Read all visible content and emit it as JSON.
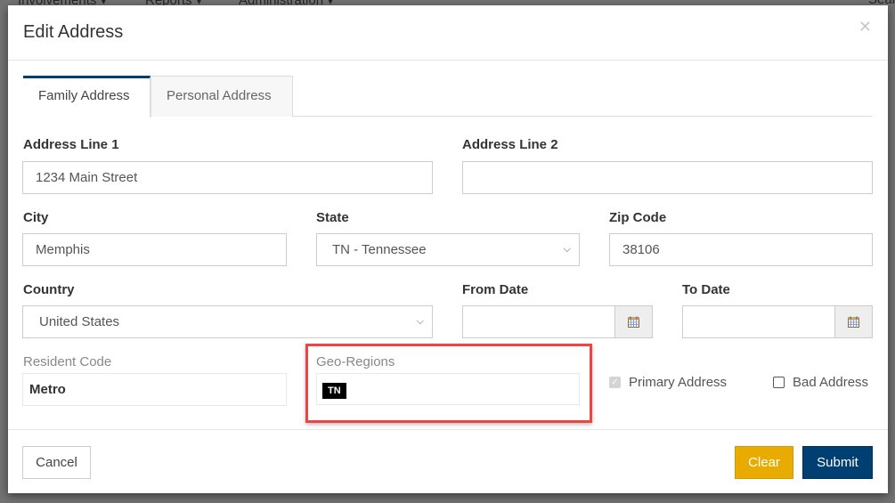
{
  "background": {
    "nav_items": [
      "Involvements ▾",
      "Reports ▾",
      "Administration ▾"
    ],
    "search_label": "Sear"
  },
  "modal": {
    "title": "Edit Address",
    "close_icon": "close-icon",
    "tabs": [
      {
        "label": "Family Address",
        "active": true
      },
      {
        "label": "Personal Address",
        "active": false
      }
    ],
    "fields": {
      "address_line_1": {
        "label": "Address Line 1",
        "value": "1234 Main Street"
      },
      "address_line_2": {
        "label": "Address Line 2",
        "value": ""
      },
      "city": {
        "label": "City",
        "value": "Memphis"
      },
      "state": {
        "label": "State",
        "value": "TN - Tennessee"
      },
      "zip": {
        "label": "Zip Code",
        "value": "38106"
      },
      "country": {
        "label": "Country",
        "value": "United States"
      },
      "from_date": {
        "label": "From Date",
        "value": "",
        "icon": "calendar-icon"
      },
      "to_date": {
        "label": "To Date",
        "value": "",
        "icon": "calendar-icon"
      },
      "resident_code": {
        "label": "Resident Code",
        "value": "Metro"
      },
      "geo_regions": {
        "label": "Geo-Regions",
        "tags": [
          "TN"
        ]
      }
    },
    "checkboxes": {
      "primary_address": {
        "label": "Primary Address",
        "checked": true,
        "disabled": true
      },
      "bad_address": {
        "label": "Bad Address",
        "checked": false,
        "disabled": false
      }
    },
    "footer": {
      "cancel_label": "Cancel",
      "clear_label": "Clear",
      "submit_label": "Submit"
    },
    "colors": {
      "primary": "#003f72",
      "warning": "#e8ac00",
      "highlight": "#ef4444"
    }
  }
}
